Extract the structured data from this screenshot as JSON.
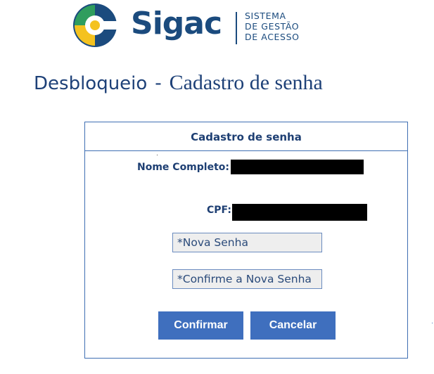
{
  "logo": {
    "wordmark": "Sigac",
    "subtitle_lines": [
      "SISTEMA",
      "DE GESTÃO",
      "DE ACESSO"
    ],
    "colors": {
      "navy": "#1b4b7e",
      "green": "#2f9d5e",
      "yellow": "#f4c21f",
      "blue": "#2f6fae"
    }
  },
  "page": {
    "title_part1": "Desbloqueio",
    "title_separator": "-",
    "title_part2": "Cadastro de senha"
  },
  "panel": {
    "header": "Cadastro de senha",
    "nome_label": "Nome Completo:",
    "cpf_label": "CPF:",
    "new_password_placeholder": "*Nova Senha",
    "confirm_password_placeholder": "*Confirme a Nova Senha",
    "confirm_button": "Confirmar",
    "cancel_button": "Cancelar"
  },
  "colors": {
    "accent": "#3f6fbe",
    "text": "#1e3f73",
    "border": "#3f6fb3"
  }
}
